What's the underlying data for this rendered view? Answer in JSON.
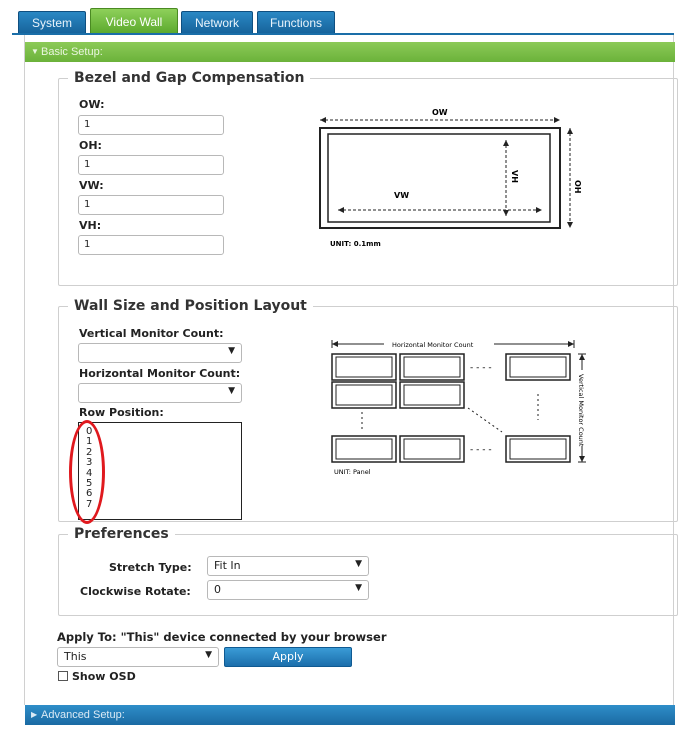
{
  "tabs": [
    {
      "label": "System",
      "active": false
    },
    {
      "label": "Video Wall",
      "active": true
    },
    {
      "label": "Network",
      "active": false
    },
    {
      "label": "Functions",
      "active": false
    }
  ],
  "basic_setup": {
    "header": "Basic Setup:",
    "bezel": {
      "title": "Bezel and Gap Compensation",
      "fields": [
        {
          "label": "OW:",
          "value": "1"
        },
        {
          "label": "OH:",
          "value": "1"
        },
        {
          "label": "VW:",
          "value": "1"
        },
        {
          "label": "VH:",
          "value": "1"
        }
      ],
      "diagram": {
        "ow": "OW",
        "oh": "OH",
        "vw": "VW",
        "vh": "VH",
        "unit": "UNIT: 0.1mm"
      }
    },
    "wall": {
      "title": "Wall Size and Position Layout",
      "vertical_label": "Vertical Monitor Count:",
      "vertical_value": "",
      "horizontal_label": "Horizontal Monitor Count:",
      "horizontal_value": "",
      "row_label": "Row Position:",
      "row_options": [
        "0",
        "1",
        "2",
        "3",
        "4",
        "5",
        "6",
        "7"
      ],
      "diagram": {
        "horizontal": "Horizontal Monitor Count",
        "vertical": "Vertical Monitor Count",
        "unit": "UNIT: Panel"
      }
    },
    "preferences": {
      "title": "Preferences",
      "stretch_label": "Stretch Type:",
      "stretch_value": "Fit In",
      "rotate_label": "Clockwise Rotate:",
      "rotate_value": "0"
    },
    "apply_to_label": "Apply To: \"This\" device connected by your browser",
    "apply_to_value": "This",
    "apply_button": "Apply",
    "show_osd_label": "Show OSD"
  },
  "advanced_setup": {
    "header": "Advanced Setup:"
  },
  "colors": {
    "accent_green": "#6bb23a",
    "accent_blue": "#1a6ea8",
    "highlight_red": "#e0191e"
  }
}
